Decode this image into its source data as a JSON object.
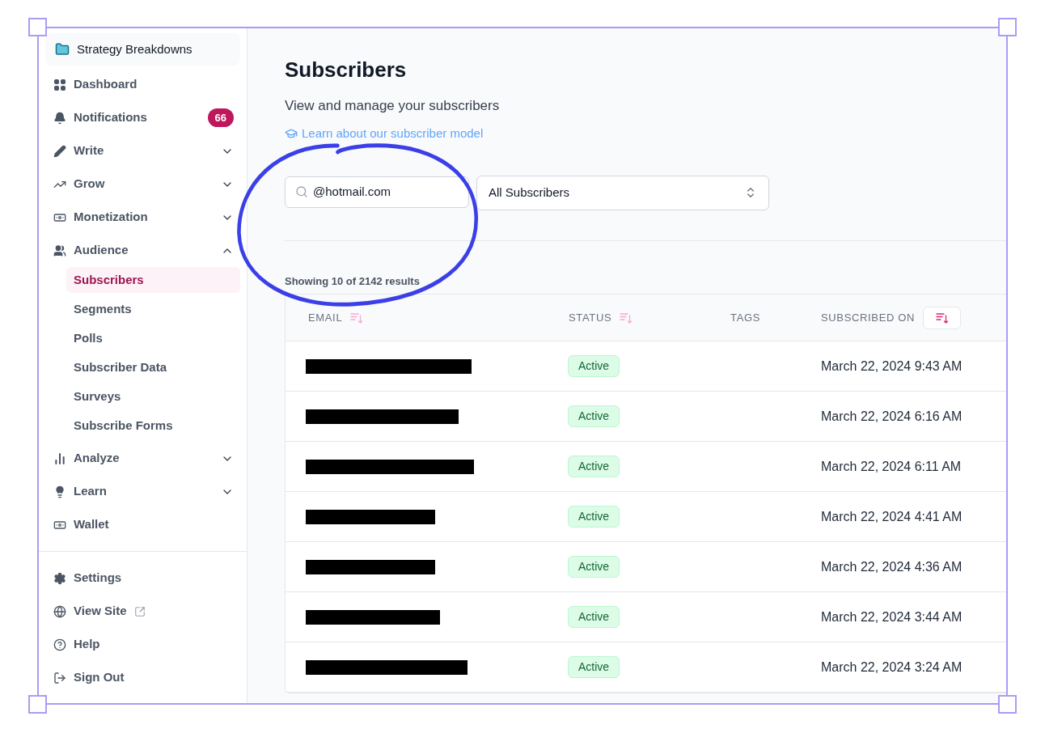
{
  "workspace": {
    "name": "Strategy Breakdowns"
  },
  "sidebar": {
    "items": [
      {
        "kind": "link",
        "label": "Dashboard"
      },
      {
        "kind": "link",
        "label": "Notifications",
        "badge": "66"
      },
      {
        "kind": "group",
        "label": "Write",
        "expanded": false
      },
      {
        "kind": "group",
        "label": "Grow",
        "expanded": false
      },
      {
        "kind": "group",
        "label": "Monetization",
        "expanded": false
      },
      {
        "kind": "group",
        "label": "Audience",
        "expanded": true,
        "children": [
          {
            "label": "Subscribers",
            "selected": true
          },
          {
            "label": "Segments",
            "selected": false
          },
          {
            "label": "Polls",
            "selected": false
          },
          {
            "label": "Subscriber Data",
            "selected": false
          },
          {
            "label": "Surveys",
            "selected": false
          },
          {
            "label": "Subscribe Forms",
            "selected": false
          }
        ]
      },
      {
        "kind": "group",
        "label": "Analyze",
        "expanded": false
      },
      {
        "kind": "group",
        "label": "Learn",
        "expanded": false
      },
      {
        "kind": "link",
        "label": "Wallet"
      }
    ],
    "footer": [
      {
        "label": "Settings"
      },
      {
        "label": "View Site",
        "external": true
      },
      {
        "label": "Help"
      },
      {
        "label": "Sign Out"
      }
    ]
  },
  "page": {
    "title": "Subscribers",
    "subtitle": "View and manage your subscribers",
    "link": "Learn about our subscriber model"
  },
  "filters": {
    "search": {
      "value": "@hotmail.com"
    },
    "select": {
      "value": "All Subscribers"
    }
  },
  "results": "Showing 10 of 2142 results",
  "table": {
    "columns": [
      {
        "label": "EMAIL",
        "sortable": true,
        "sort_active": false
      },
      {
        "label": "STATUS",
        "sortable": true,
        "sort_active": false
      },
      {
        "label": "TAGS",
        "sortable": false
      },
      {
        "label": "SUBSCRIBED ON",
        "sortable": true,
        "sort_active": true
      }
    ],
    "rows": [
      {
        "status": "Active",
        "subscribed_on": "March 22, 2024 9:43 AM"
      },
      {
        "status": "Active",
        "subscribed_on": "March 22, 2024 6:16 AM"
      },
      {
        "status": "Active",
        "subscribed_on": "March 22, 2024 6:11 AM"
      },
      {
        "status": "Active",
        "subscribed_on": "March 22, 2024 4:41 AM"
      },
      {
        "status": "Active",
        "subscribed_on": "March 22, 2024 4:36 AM"
      },
      {
        "status": "Active",
        "subscribed_on": "March 22, 2024 3:44 AM"
      },
      {
        "status": "Active",
        "subscribed_on": "March 22, 2024 3:24 AM"
      }
    ]
  }
}
